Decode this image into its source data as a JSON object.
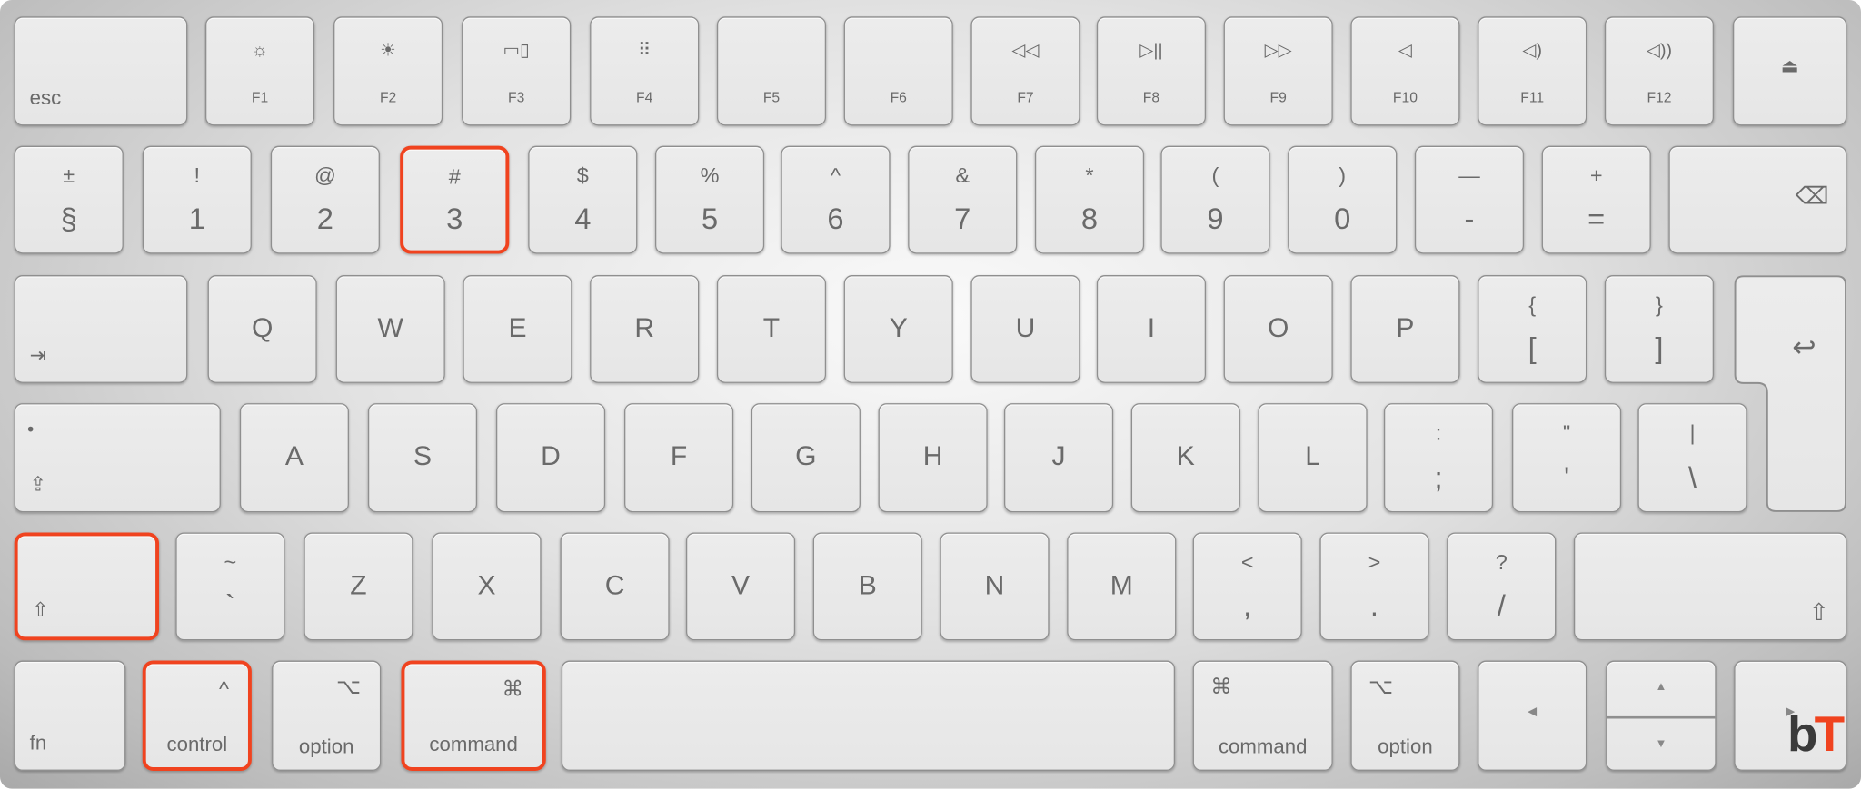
{
  "highlight_color": "#f0431f",
  "logo": {
    "b": "b",
    "t": "T"
  },
  "rows": [
    [
      {
        "name": "esc",
        "top": "",
        "bottom": "esc",
        "align": "bl"
      },
      {
        "name": "f1",
        "top": "☼",
        "bottom": "F1",
        "align": "fn",
        "icon": "brightness-down-icon"
      },
      {
        "name": "f2",
        "top": "☀",
        "bottom": "F2",
        "align": "fn",
        "icon": "brightness-up-icon"
      },
      {
        "name": "f3",
        "top": "▭▯",
        "bottom": "F3",
        "align": "fn",
        "icon": "mission-control-icon"
      },
      {
        "name": "f4",
        "top": "⠿",
        "bottom": "F4",
        "align": "fn",
        "icon": "launchpad-icon"
      },
      {
        "name": "f5",
        "top": "",
        "bottom": "F5",
        "align": "fn"
      },
      {
        "name": "f6",
        "top": "",
        "bottom": "F6",
        "align": "fn"
      },
      {
        "name": "f7",
        "top": "◁◁",
        "bottom": "F7",
        "align": "fn",
        "icon": "rewind-icon"
      },
      {
        "name": "f8",
        "top": "▷||",
        "bottom": "F8",
        "align": "fn",
        "icon": "play-pause-icon"
      },
      {
        "name": "f9",
        "top": "▷▷",
        "bottom": "F9",
        "align": "fn",
        "icon": "fast-forward-icon"
      },
      {
        "name": "f10",
        "top": "◁",
        "bottom": "F10",
        "align": "fn",
        "icon": "mute-icon"
      },
      {
        "name": "f11",
        "top": "◁)",
        "bottom": "F11",
        "align": "fn",
        "icon": "volume-down-icon"
      },
      {
        "name": "f12",
        "top": "◁))",
        "bottom": "F12",
        "align": "fn",
        "icon": "volume-up-icon"
      },
      {
        "name": "eject",
        "top": "",
        "bottom": "⏏",
        "align": "center",
        "icon": "eject-icon"
      }
    ],
    [
      {
        "name": "section",
        "top": "±",
        "bottom": "§",
        "align": "dual"
      },
      {
        "name": "1",
        "top": "!",
        "bottom": "1",
        "align": "dual"
      },
      {
        "name": "2",
        "top": "@",
        "bottom": "2",
        "align": "dual"
      },
      {
        "name": "3",
        "top": "#",
        "bottom": "3",
        "align": "dual",
        "highlighted": true
      },
      {
        "name": "4",
        "top": "$",
        "bottom": "4",
        "align": "dual"
      },
      {
        "name": "5",
        "top": "%",
        "bottom": "5",
        "align": "dual"
      },
      {
        "name": "6",
        "top": "^",
        "bottom": "6",
        "align": "dual"
      },
      {
        "name": "7",
        "top": "&",
        "bottom": "7",
        "align": "dual"
      },
      {
        "name": "8",
        "top": "*",
        "bottom": "8",
        "align": "dual"
      },
      {
        "name": "9",
        "top": "(",
        "bottom": "9",
        "align": "dual"
      },
      {
        "name": "0",
        "top": ")",
        "bottom": "0",
        "align": "dual"
      },
      {
        "name": "minus",
        "top": "—",
        "bottom": "-",
        "align": "dual"
      },
      {
        "name": "equals",
        "top": "+",
        "bottom": "=",
        "align": "dual"
      },
      {
        "name": "delete",
        "top": "",
        "bottom": "⌫",
        "align": "rmid",
        "icon": "backspace-icon"
      }
    ],
    [
      {
        "name": "tab",
        "top": "",
        "bottom": "⇥",
        "align": "bl",
        "icon": "tab-icon"
      },
      {
        "name": "q",
        "top": "",
        "bottom": "Q",
        "align": "single"
      },
      {
        "name": "w",
        "top": "",
        "bottom": "W",
        "align": "single"
      },
      {
        "name": "e",
        "top": "",
        "bottom": "E",
        "align": "single"
      },
      {
        "name": "r",
        "top": "",
        "bottom": "R",
        "align": "single"
      },
      {
        "name": "t",
        "top": "",
        "bottom": "T",
        "align": "single"
      },
      {
        "name": "y",
        "top": "",
        "bottom": "Y",
        "align": "single"
      },
      {
        "name": "u",
        "top": "",
        "bottom": "U",
        "align": "single"
      },
      {
        "name": "i",
        "top": "",
        "bottom": "I",
        "align": "single"
      },
      {
        "name": "o",
        "top": "",
        "bottom": "O",
        "align": "single"
      },
      {
        "name": "p",
        "top": "",
        "bottom": "P",
        "align": "single"
      },
      {
        "name": "left-bracket",
        "top": "{",
        "bottom": "[",
        "align": "dual"
      },
      {
        "name": "right-bracket",
        "top": "}",
        "bottom": "]",
        "align": "dual"
      }
    ],
    [
      {
        "name": "caps-lock",
        "top": "•",
        "bottom": "⇪",
        "align": "bl",
        "icon": "caps-lock-icon"
      },
      {
        "name": "a",
        "top": "",
        "bottom": "A",
        "align": "single"
      },
      {
        "name": "s",
        "top": "",
        "bottom": "S",
        "align": "single"
      },
      {
        "name": "d",
        "top": "",
        "bottom": "D",
        "align": "single"
      },
      {
        "name": "f",
        "top": "",
        "bottom": "F",
        "align": "single"
      },
      {
        "name": "g",
        "top": "",
        "bottom": "G",
        "align": "single"
      },
      {
        "name": "h",
        "top": "",
        "bottom": "H",
        "align": "single"
      },
      {
        "name": "j",
        "top": "",
        "bottom": "J",
        "align": "single"
      },
      {
        "name": "k",
        "top": "",
        "bottom": "K",
        "align": "single"
      },
      {
        "name": "l",
        "top": "",
        "bottom": "L",
        "align": "single"
      },
      {
        "name": "semicolon",
        "top": ":",
        "bottom": ";",
        "align": "dual"
      },
      {
        "name": "quote",
        "top": "\"",
        "bottom": "'",
        "align": "dual"
      },
      {
        "name": "backslash",
        "top": "|",
        "bottom": "\\",
        "align": "dual"
      }
    ],
    [
      {
        "name": "left-shift",
        "top": "",
        "bottom": "⇧",
        "align": "bl",
        "icon": "shift-icon",
        "highlighted": true
      },
      {
        "name": "grave",
        "top": "~",
        "bottom": "`",
        "align": "dual"
      },
      {
        "name": "z",
        "top": "",
        "bottom": "Z",
        "align": "single"
      },
      {
        "name": "x",
        "top": "",
        "bottom": "X",
        "align": "single"
      },
      {
        "name": "c",
        "top": "",
        "bottom": "C",
        "align": "single"
      },
      {
        "name": "v",
        "top": "",
        "bottom": "V",
        "align": "single"
      },
      {
        "name": "b",
        "top": "",
        "bottom": "B",
        "align": "single"
      },
      {
        "name": "n",
        "top": "",
        "bottom": "N",
        "align": "single"
      },
      {
        "name": "m",
        "top": "",
        "bottom": "M",
        "align": "single"
      },
      {
        "name": "comma",
        "top": "<",
        "bottom": ",",
        "align": "dual"
      },
      {
        "name": "period",
        "top": ">",
        "bottom": ".",
        "align": "dual"
      },
      {
        "name": "slash",
        "top": "?",
        "bottom": "/",
        "align": "dual"
      },
      {
        "name": "right-shift",
        "top": "",
        "bottom": "⇧",
        "align": "br",
        "icon": "shift-icon"
      }
    ],
    [
      {
        "name": "fn",
        "top": "",
        "bottom": "fn",
        "align": "bl"
      },
      {
        "name": "left-control",
        "top": "^",
        "bottom": "control",
        "align": "modr",
        "highlighted": true
      },
      {
        "name": "left-option",
        "top": "⌥",
        "bottom": "option",
        "align": "modr"
      },
      {
        "name": "left-command",
        "top": "⌘",
        "bottom": "command",
        "align": "modr",
        "highlighted": true
      },
      {
        "name": "space",
        "top": "",
        "bottom": "",
        "align": "single"
      },
      {
        "name": "right-command",
        "top": "⌘",
        "bottom": "command",
        "align": "modl"
      },
      {
        "name": "right-option",
        "top": "⌥",
        "bottom": "option",
        "align": "modl"
      },
      {
        "name": "arrow-left",
        "top": "",
        "bottom": "◀",
        "align": "arrow",
        "icon": "arrow-left-icon"
      },
      {
        "name": "arrow-up-down",
        "top": "▲",
        "bottom": "▼",
        "align": "updown",
        "icon": "arrow-up-down-icon"
      },
      {
        "name": "arrow-right",
        "top": "",
        "bottom": "▶",
        "align": "arrow",
        "icon": "arrow-right-icon"
      }
    ]
  ],
  "return_key": {
    "label": "↩",
    "icon": "return-icon"
  }
}
